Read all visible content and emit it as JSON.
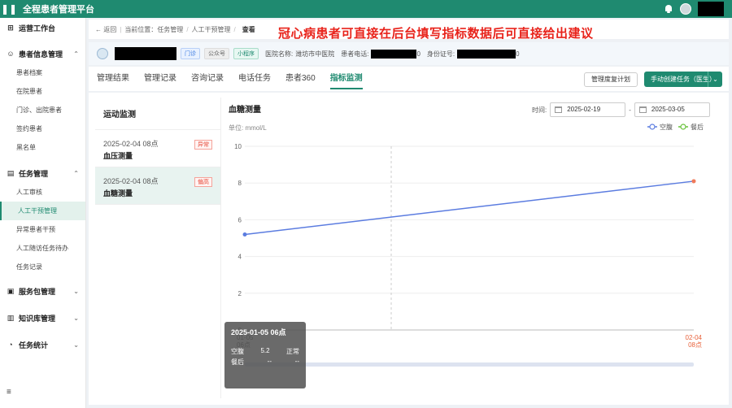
{
  "app": {
    "title": "全程患者管理平台"
  },
  "sidebar": {
    "items": [
      {
        "label": "运营工作台",
        "group": true,
        "icon": "grid-icon"
      },
      {
        "label": "患者信息管理",
        "group": true,
        "icon": "user-icon",
        "expanded": true
      },
      {
        "label": "患者档案",
        "group": false
      },
      {
        "label": "在院患者",
        "group": false
      },
      {
        "label": "门诊、出院患者",
        "group": false
      },
      {
        "label": "签约患者",
        "group": false
      },
      {
        "label": "黑名单",
        "group": false
      },
      {
        "label": "任务管理",
        "group": true,
        "icon": "task-icon",
        "expanded": true
      },
      {
        "label": "人工审核",
        "group": false
      },
      {
        "label": "人工干预管理",
        "group": false,
        "active": true
      },
      {
        "label": "异常患者干预",
        "group": false
      },
      {
        "label": "人工随访任务待办",
        "group": false
      },
      {
        "label": "任务记录",
        "group": false
      },
      {
        "label": "服务包管理",
        "group": true,
        "icon": "package-icon"
      },
      {
        "label": "知识库管理",
        "group": true,
        "icon": "book-icon"
      },
      {
        "label": "任务统计",
        "group": true,
        "icon": "stats-icon"
      }
    ],
    "footer": "≡"
  },
  "breadcrumb": {
    "back": "← 返回",
    "location": "当前位置：",
    "level1": "任务管理",
    "level2": "人工干预管理",
    "current": "查看"
  },
  "headline": "冠心病患者可直接在后台填写指标数据后可直接给出建议",
  "patient": {
    "tag1": "门诊",
    "tag2": "公众号",
    "tag3": "小程序",
    "hospital_label": "医院名称:",
    "hospital": "潍坊市中医院",
    "phone_label": "患者电话:",
    "phone_suffix": "0",
    "id_label": "身份证号:",
    "id_suffix": "0"
  },
  "tabs": [
    "管理结果",
    "管理记录",
    "咨询记录",
    "电话任务",
    "患者360",
    "指标监测"
  ],
  "active_tab": "指标监测",
  "buttons": {
    "plan": "管理度复计划",
    "create": "手动创建任务（医生）"
  },
  "left_panel": {
    "title": "运动监测",
    "records": [
      {
        "time": "2025-02-04 08点",
        "name": "血压测量",
        "badge": "异常"
      },
      {
        "time": "2025-02-04 08点",
        "name": "血糖测量",
        "badge": "偏高"
      }
    ]
  },
  "chart_header": {
    "title": "血糖测量",
    "time_label": "时间:",
    "start": "2025-02-19",
    "sep": "-",
    "end": "2025-03-05"
  },
  "chart_data": {
    "type": "line",
    "ylabel": "单位: mmol/L",
    "ylim": [
      0,
      10
    ],
    "yticks": [
      0,
      2,
      4,
      6,
      8,
      10
    ],
    "xticks": [
      [
        "01-05",
        "06点"
      ],
      [
        "02-04",
        "08点"
      ]
    ],
    "grid": true,
    "legend_position": "top-right",
    "series": [
      {
        "name": "空腹",
        "color": "#5b7ce0",
        "x": [
          "01-05 06点",
          "02-04 08点"
        ],
        "values": [
          5.2,
          8.1
        ]
      },
      {
        "name": "餐后",
        "color": "#67c23a",
        "x": [],
        "values": []
      }
    ]
  },
  "tooltip": {
    "title": "2025-01-05 06点",
    "rows": [
      {
        "label": "空腹",
        "value": "5.2",
        "status": "正常"
      },
      {
        "label": "餐后",
        "value": "--",
        "status": "--"
      }
    ]
  },
  "colors": {
    "primary": "#1f8a70",
    "alert": "#e8231b"
  }
}
